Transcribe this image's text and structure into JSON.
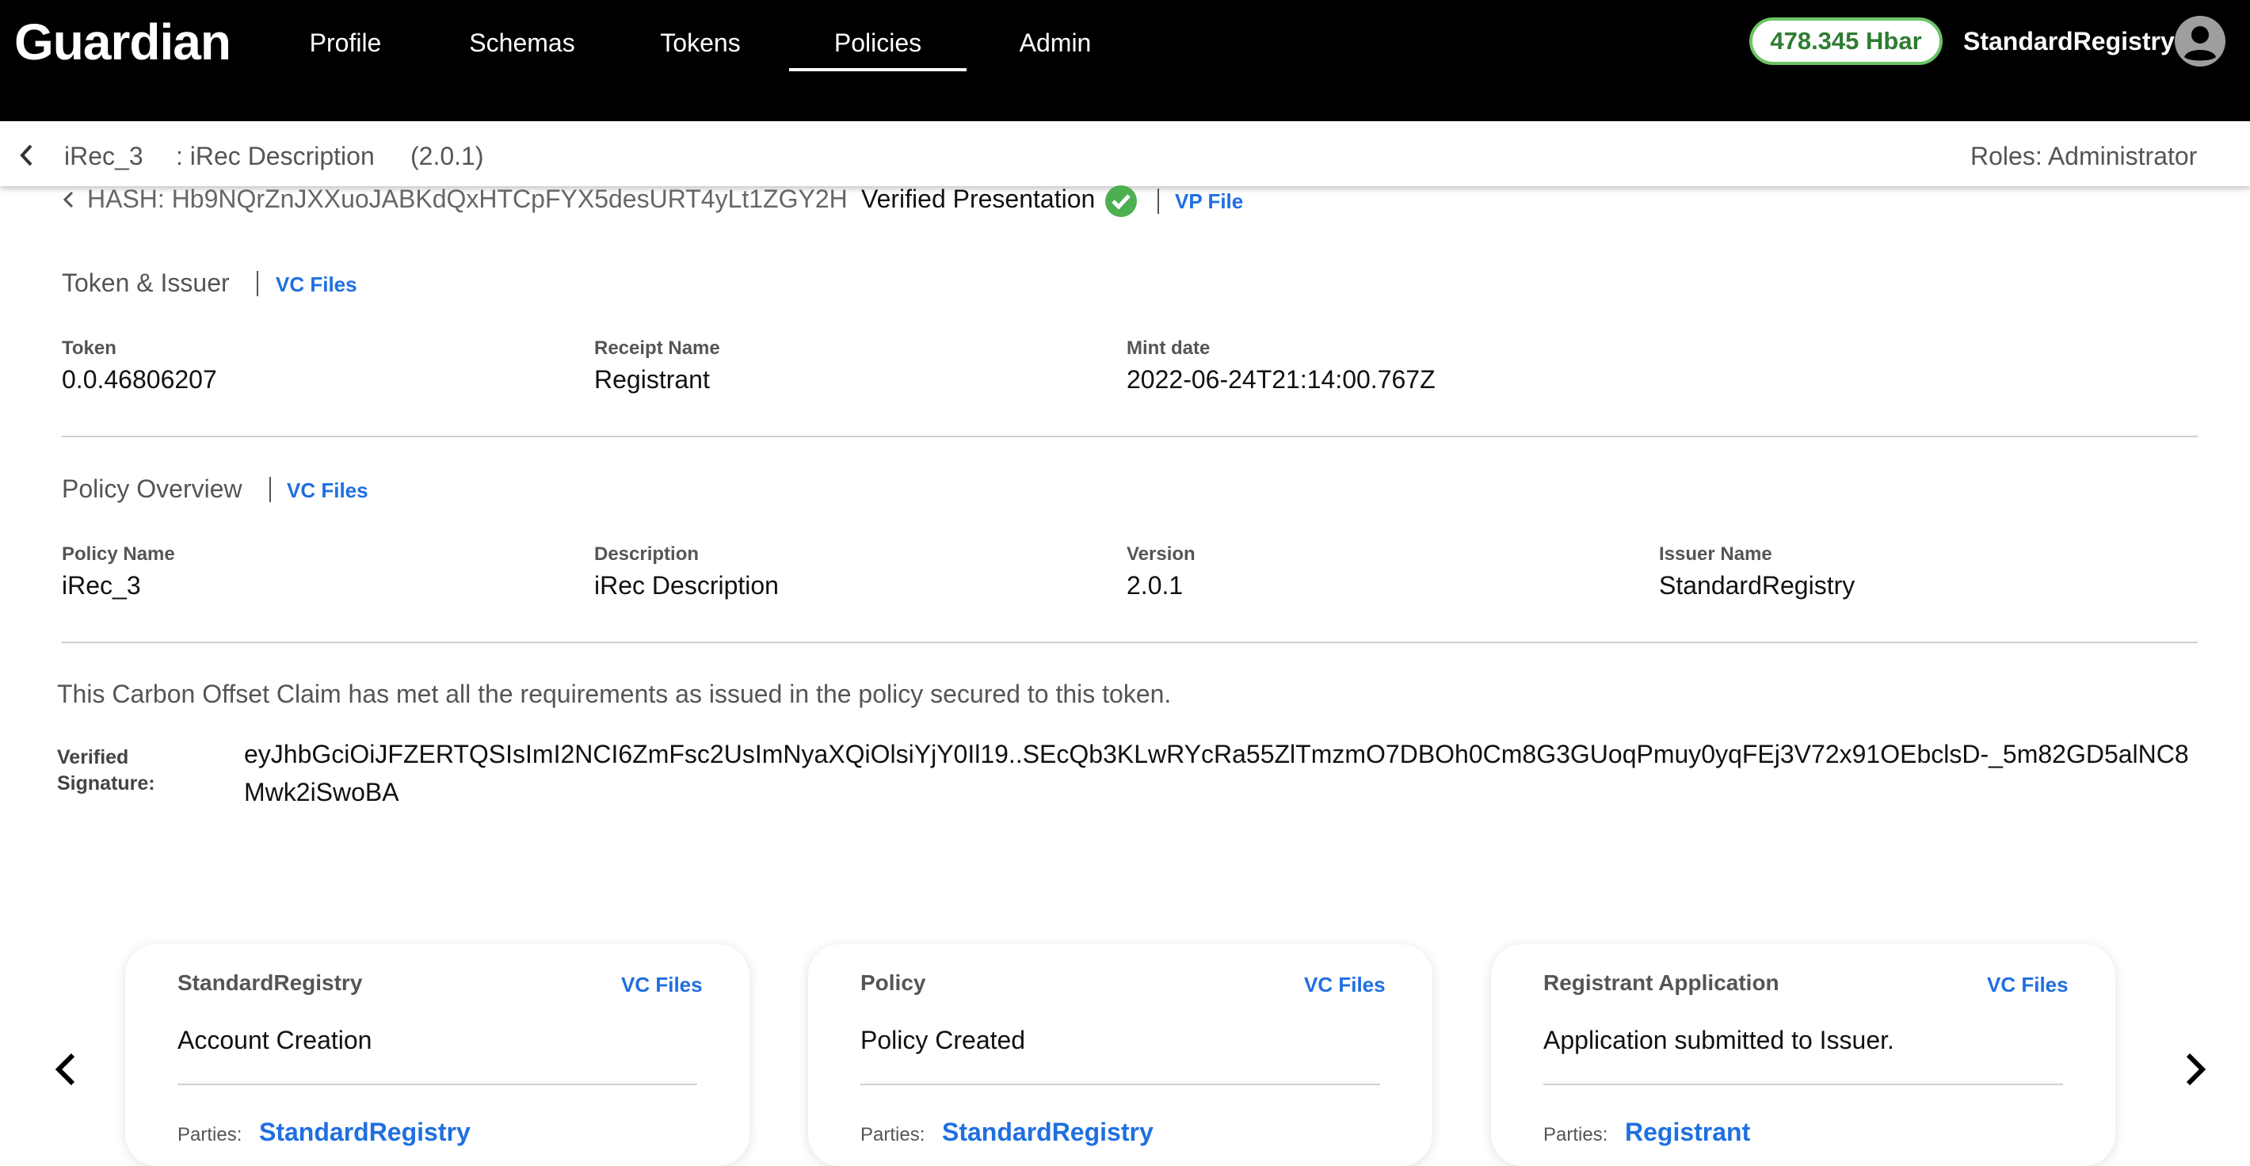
{
  "app": {
    "logo": "Guardian",
    "nav": [
      {
        "label": "Profile"
      },
      {
        "label": "Schemas"
      },
      {
        "label": "Tokens"
      },
      {
        "label": "Policies",
        "active": true
      },
      {
        "label": "Admin"
      }
    ],
    "balance": "478.345 Hbar",
    "username": "StandardRegistry",
    "avatar_icon": "user-avatar-icon"
  },
  "subheader": {
    "policy_name": "iRec_3",
    "policy_description": ": iRec Description",
    "policy_version": "(2.0.1)",
    "roles": "Roles: Administrator"
  },
  "vp": {
    "hash": "HASH: Hb9NQrZnJXXuoJABKdQxHTCpFYX5desURT4yLt1ZGY2H",
    "title": "Verified Presentation",
    "file_link": "VP File"
  },
  "token_section": {
    "title": "Token & Issuer",
    "link": "VC Files",
    "fields": [
      {
        "label": "Token",
        "value": "0.0.46806207"
      },
      {
        "label": "Receipt Name",
        "value": "Registrant"
      },
      {
        "label": "Mint date",
        "value": "2022-06-24T21:14:00.767Z"
      }
    ]
  },
  "policy_section": {
    "title": "Policy Overview",
    "link": "VC Files",
    "fields": [
      {
        "label": "Policy Name",
        "value": "iRec_3"
      },
      {
        "label": "Description",
        "value": "iRec Description"
      },
      {
        "label": "Version",
        "value": "2.0.1"
      },
      {
        "label": "Issuer Name",
        "value": "StandardRegistry"
      }
    ]
  },
  "statement": "This Carbon Offset Claim has met all the requirements as issued in the policy secured to this token.",
  "signature": {
    "label": "Verified Signature:",
    "value": "eyJhbGciOiJFZERTQSIsImI2NCI6ZmFsc2UsImNyaXQiOlsiYjY0Il19..SEcQb3KLwRYcRa55ZlTmzmO7DBOh0Cm8G3GUoqPmuy0yqFEj3V72x91OEbclsD-_5m82GD5alNC8Mwk2iSwoBA"
  },
  "cards": [
    {
      "title": "StandardRegistry",
      "link": "VC Files",
      "description": "Account Creation",
      "parties_label": "Parties:",
      "parties_value": "StandardRegistry"
    },
    {
      "title": "Policy",
      "link": "VC Files",
      "description": "Policy Created",
      "parties_label": "Parties:",
      "parties_value": "StandardRegistry"
    },
    {
      "title": "Registrant Application",
      "link": "VC Files",
      "description": "Application submitted to Issuer.",
      "parties_label": "Parties:",
      "parties_value": "Registrant"
    }
  ],
  "colors": {
    "topbar": "#000000",
    "link": "#1f6fe0",
    "balance_border": "#6bc464",
    "balance_text": "#2e7d32",
    "verified_check": "#4caf50"
  }
}
